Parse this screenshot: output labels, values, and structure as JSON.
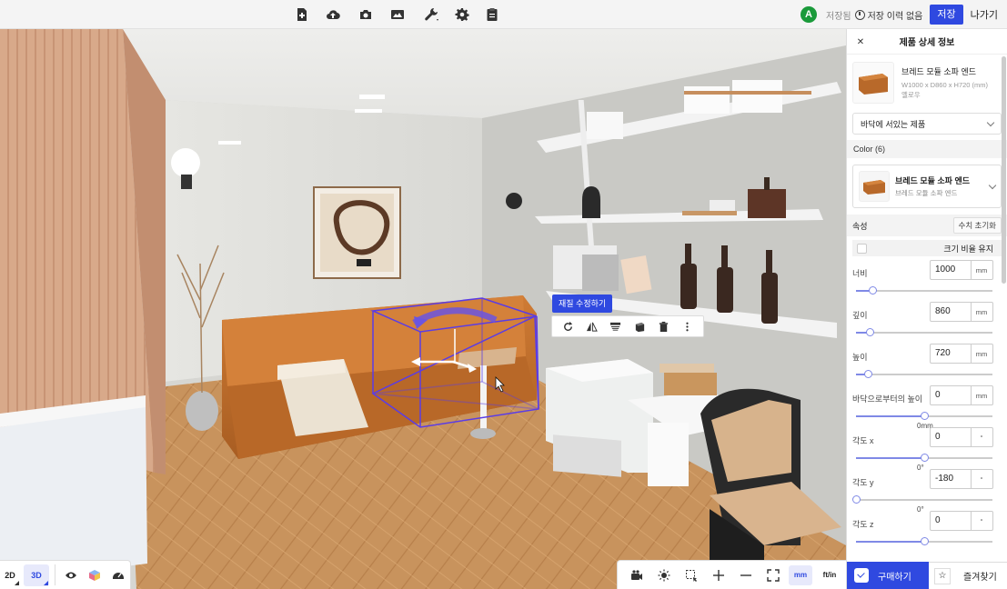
{
  "topbar": {
    "icons": [
      "add-page-icon",
      "cloud-upload-icon",
      "camera-icon",
      "image-icon",
      "wrench-icon",
      "gear-icon",
      "clipboard-icon"
    ],
    "avatar_letter": "A",
    "save_status": "저장됨",
    "history_label": "저장 이력 없음",
    "save_label": "저장",
    "exit_label": "나가기"
  },
  "panel": {
    "title": "제품 상세 정보",
    "product": {
      "name": "브레드 모듈 소파 엔드",
      "dimensions": "W1000 x D860 x H720 (mm)",
      "color_name": "옐로우"
    },
    "placement_select": "바닥에 서있는 제품",
    "color_section": "Color (6)",
    "color_card": {
      "name": "브레드 모듈 소파 엔드",
      "sub": "브레드 모듈 소파 엔드"
    },
    "attributes_label": "속성",
    "reset_label": "수치 초기화",
    "keep_ratio_label": "크기 비율 유지",
    "fields": [
      {
        "label": "너비",
        "value": "1000",
        "unit": "mm",
        "slider": 0.12,
        "slider_label": ""
      },
      {
        "label": "깊이",
        "value": "860",
        "unit": "mm",
        "slider": 0.1,
        "slider_label": ""
      },
      {
        "label": "높이",
        "value": "720",
        "unit": "mm",
        "slider": 0.09,
        "slider_label": ""
      },
      {
        "label": "바닥으로부터의 높이",
        "value": "0",
        "unit": "mm",
        "slider": 0.5,
        "slider_label": "0mm"
      },
      {
        "label": "각도 x",
        "value": "0",
        "unit": "°",
        "slider": 0.5,
        "slider_label": "0°"
      },
      {
        "label": "각도 y",
        "value": "-180",
        "unit": "°",
        "slider": 0.0,
        "slider_label": "0°"
      },
      {
        "label": "각도 z",
        "value": "0",
        "unit": "°",
        "slider": 0.5,
        "slider_label": ""
      }
    ],
    "buy_label": "구매하기",
    "fav_label": "즐겨찾기"
  },
  "bottom_left": {
    "mode_2d": "2D",
    "mode_3d": "3D",
    "active_mode": "3D"
  },
  "bottom_right": {
    "unit_mm": "mm",
    "unit_ftin": "ft/in",
    "active_unit": "mm"
  },
  "object_toolbar": {
    "material_label": "재질 수정하기"
  },
  "colors": {
    "accent": "#2f49e0",
    "selection_box": "#5a3ce6",
    "sofa": "#c4722e",
    "floor": "#c89460"
  }
}
